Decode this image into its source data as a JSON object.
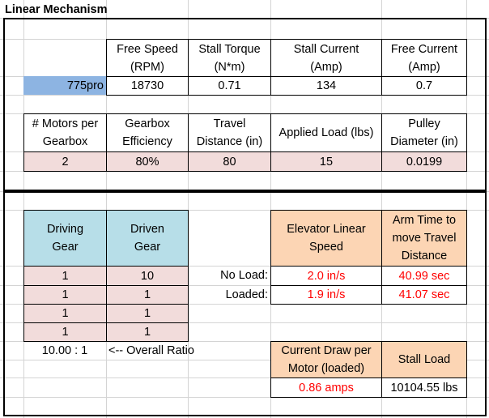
{
  "title": "Linear Mechanism",
  "motor_specs": {
    "headers": [
      "Free Speed (RPM)",
      "Stall Torque (N*m)",
      "Stall Current (Amp)",
      "Free Current (Amp)"
    ],
    "header_lines": [
      [
        "Free Speed",
        "(RPM)"
      ],
      [
        "Stall Torque",
        "(N*m)"
      ],
      [
        "Stall Current",
        "(Amp)"
      ],
      [
        "Free Current",
        "(Amp)"
      ]
    ],
    "motor_name": "775pro",
    "values": [
      "18730",
      "0.71",
      "134",
      "0.7"
    ]
  },
  "mechanism_inputs": {
    "header_lines": [
      [
        "# Motors per",
        "Gearbox"
      ],
      [
        "Gearbox",
        "Efficiency"
      ],
      [
        "Travel",
        "Distance (in)"
      ],
      [
        "Applied Load (lbs)"
      ],
      [
        "Pulley",
        "Diameter (in)"
      ]
    ],
    "values": [
      "2",
      "80%",
      "80",
      "15",
      "0.0199"
    ]
  },
  "gears": {
    "driving_header": [
      "Driving",
      "Gear"
    ],
    "driven_header": [
      "Driven",
      "Gear"
    ],
    "rows": [
      [
        "1",
        "10"
      ],
      [
        "1",
        "1"
      ],
      [
        "1",
        "1"
      ],
      [
        "1",
        "1"
      ]
    ],
    "overall_ratio": "10.00 : 1",
    "overall_ratio_label": "<-- Overall Ratio"
  },
  "results": {
    "speed_header": [
      "Elevator Linear",
      "Speed"
    ],
    "time_header": [
      "Arm Time to",
      "move Travel",
      "Distance"
    ],
    "no_load_label": "No Load:",
    "loaded_label": "Loaded:",
    "no_load_speed": "2.0 in/s",
    "no_load_time": "40.99 sec",
    "loaded_speed": "1.9 in/s",
    "loaded_time": "41.07 sec",
    "current_header": [
      "Current Draw per",
      "Motor (loaded)"
    ],
    "stall_load_header": "Stall Load",
    "current_value": "0.86 amps",
    "stall_load_value": "10104.55 lbs"
  },
  "colors": {
    "input_fill": "#f2dcdb",
    "gear_header_fill": "#b7dee8",
    "result_header_fill": "#fcd5b4",
    "selected_fill": "#8db4e2",
    "output_text": "#ff0000"
  }
}
